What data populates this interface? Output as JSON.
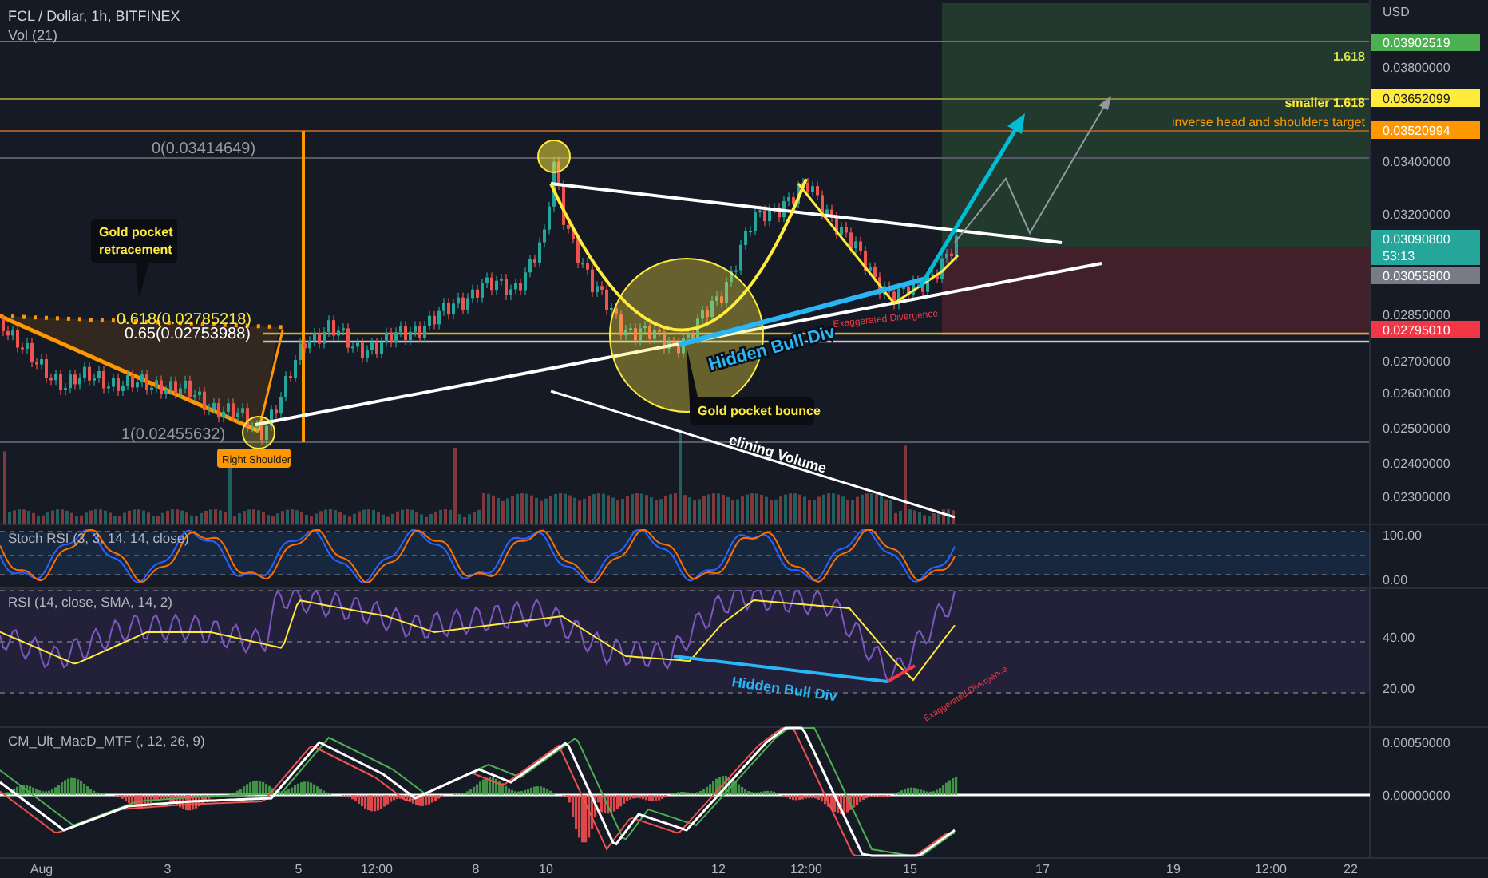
{
  "header": {
    "symbol": "FCL / Dollar, 1h, BITFINEX",
    "volume_label": "Vol (21)"
  },
  "annotations": [
    {
      "kind": "callout",
      "lines": [
        "Gold pocket",
        "retracement"
      ]
    },
    {
      "kind": "fib",
      "text": "0(0.03414649)"
    },
    {
      "kind": "fib_gold",
      "text": "0.618(0.02785218)"
    },
    {
      "kind": "fib_white",
      "text": "0.65(0.02753988)"
    },
    {
      "kind": "fib",
      "text": "1(0.02455632)"
    },
    {
      "kind": "tag",
      "text": "Right Shoulder"
    },
    {
      "kind": "callout",
      "lines": [
        "Gold pocket bounce"
      ]
    },
    {
      "kind": "trend",
      "text": "Hidden Bull Div"
    },
    {
      "kind": "volume",
      "text": "clining Volume"
    },
    {
      "kind": "divergence",
      "text": "Exaggerated Divergence"
    },
    {
      "kind": "target_green",
      "text": "1.618"
    },
    {
      "kind": "target_yellow",
      "text": "smaller 1.618"
    },
    {
      "kind": "target_orange",
      "text": "inverse head and shoulders target"
    }
  ],
  "price_axis": {
    "unit": "USD",
    "ticks": [
      "0.03800000",
      "0.03400000",
      "0.03200000",
      "0.02850000",
      "0.02700000",
      "0.02600000",
      "0.02500000",
      "0.02400000",
      "0.02300000"
    ],
    "tags": [
      {
        "text": "0.03902519",
        "color": "#4caf50"
      },
      {
        "text": "0.03652099",
        "color": "#ffeb3b"
      },
      {
        "text": "0.03520994",
        "color": "#ff9800"
      },
      {
        "text": "0.03090800",
        "countdown": "53:13",
        "color": "#26a69a"
      },
      {
        "text": "0.03055800",
        "color": "#787b86"
      },
      {
        "text": "0.02795010",
        "color": "#f23645"
      }
    ]
  },
  "panes": [
    {
      "kind": "stoch",
      "title": "Stoch RSI (3, 3, 14, 14, close)",
      "ticks": [
        "100.00",
        "0.00"
      ]
    },
    {
      "kind": "rsi",
      "title": "RSI (14, close, SMA, 14, 2)",
      "ticks": [
        "40.00",
        "20.00"
      ],
      "annotations": [
        {
          "kind": "trend",
          "text": "Hidden Bull Div"
        },
        {
          "kind": "divergence",
          "text": "Exaggerated Divergence"
        }
      ]
    },
    {
      "kind": "macd",
      "title": "CM_Ult_MacD_MTF (, 12, 26, 9)",
      "ticks": [
        "0.00050000",
        "0.00000000"
      ]
    }
  ],
  "time_axis": [
    "Aug",
    "3",
    "5",
    "12:00",
    "8",
    "10",
    "12",
    "12:00",
    "15",
    "17",
    "19",
    "12:00",
    "22"
  ]
}
